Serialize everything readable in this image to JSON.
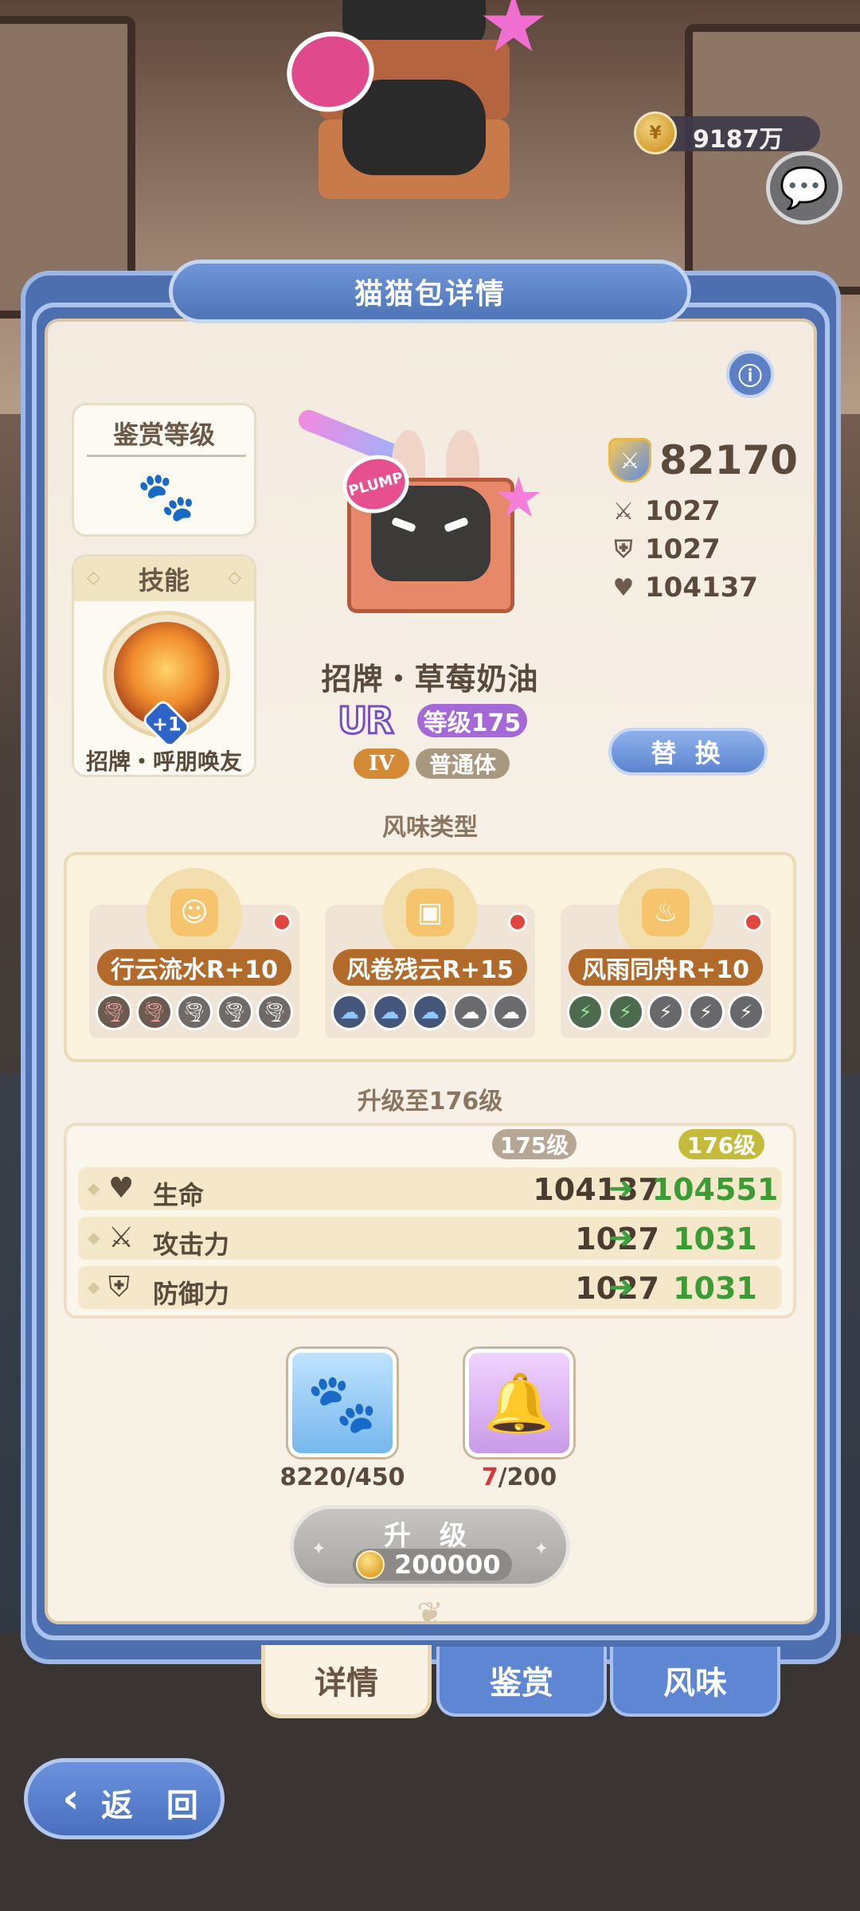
{
  "currency": {
    "amount": "9187万",
    "icon": "gold-coin-icon"
  },
  "header": {
    "title": "猫猫包详情"
  },
  "rank": {
    "title": "鉴赏等级",
    "icon": "paw-icon"
  },
  "skill": {
    "title": "技能",
    "badge": "+1",
    "name": "招牌・呼朋唤友"
  },
  "character": {
    "name": "招牌・草莓奶油",
    "rarity": "UR",
    "level": "等级175",
    "tier": "IV",
    "body_type": "普通体",
    "heart_badge": "PLUMP"
  },
  "stats": {
    "power": "82170",
    "attack": "1027",
    "defense": "1027",
    "hp": "104137"
  },
  "replace_button": "替 换",
  "flavor": {
    "title": "风味类型",
    "items": [
      {
        "label": "行云流水R+10",
        "icon": "cat-face-icon",
        "active_count": 2,
        "total": 5,
        "kind": "tornado"
      },
      {
        "label": "风卷残云R+15",
        "icon": "square-face-icon",
        "active_count": 3,
        "total": 5,
        "kind": "cloud"
      },
      {
        "label": "风雨同舟R+10",
        "icon": "fox-tail-icon",
        "active_count": 2,
        "total": 5,
        "kind": "bolt"
      }
    ]
  },
  "upgrade": {
    "title": "升级至176级",
    "current_level": "175级",
    "next_level": "176级",
    "rows": [
      {
        "label": "生命",
        "icon": "heart-icon",
        "current": "104137",
        "next": "104551"
      },
      {
        "label": "攻击力",
        "icon": "swords-icon",
        "current": "1027",
        "next": "1031"
      },
      {
        "label": "防御力",
        "icon": "shield-icon",
        "current": "1027",
        "next": "1031"
      }
    ]
  },
  "materials": [
    {
      "name": "paw-material",
      "have": "8220",
      "need": "/450"
    },
    {
      "name": "food-material",
      "have": "7",
      "need": "/200"
    }
  ],
  "upgrade_button": {
    "label": "升 级",
    "cost": "200000"
  },
  "tabs": [
    "详情",
    "鉴赏",
    "风味"
  ],
  "back_button": "返 回",
  "colors": {
    "panel_blue": "#4d6fb0",
    "accent_purple": "#a469d6",
    "increase_green": "#3a9c33",
    "flavor_brown": "#b26a2b"
  }
}
